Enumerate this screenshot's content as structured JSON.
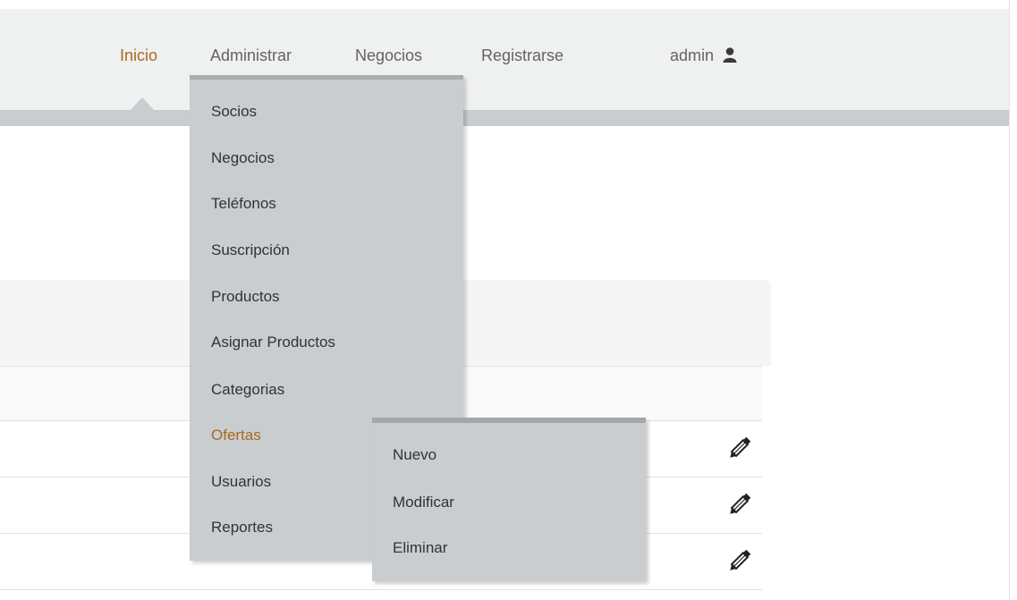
{
  "nav": {
    "items": [
      {
        "label": "Inicio",
        "active": true
      },
      {
        "label": "Administrar",
        "active": false
      },
      {
        "label": "Negocios",
        "active": false
      },
      {
        "label": "Registrarse",
        "active": false
      }
    ],
    "user": {
      "label": "admin",
      "icon": "user-icon"
    }
  },
  "admin_menu": {
    "items": [
      {
        "label": "Socios"
      },
      {
        "label": "Negocios"
      },
      {
        "label": "Teléfonos"
      },
      {
        "label": "Suscripción"
      },
      {
        "label": "Productos"
      },
      {
        "label": "Asignar Productos"
      },
      {
        "label": "Categorias"
      },
      {
        "label": "Ofertas",
        "active": true
      },
      {
        "label": "Usuarios"
      },
      {
        "label": "Reportes"
      }
    ]
  },
  "ofertas_submenu": {
    "items": [
      {
        "label": "Nuevo"
      },
      {
        "label": "Modificar"
      },
      {
        "label": "Eliminar"
      }
    ]
  },
  "table": {
    "rows": [
      {
        "edit_icon": "pencil-icon"
      },
      {
        "edit_icon": "pencil-icon"
      },
      {
        "edit_icon": "pencil-icon"
      }
    ]
  },
  "colors": {
    "active_link": "#a86a1a",
    "nav_background": "#eff0f0",
    "menu_background": "#c9cdcf"
  }
}
